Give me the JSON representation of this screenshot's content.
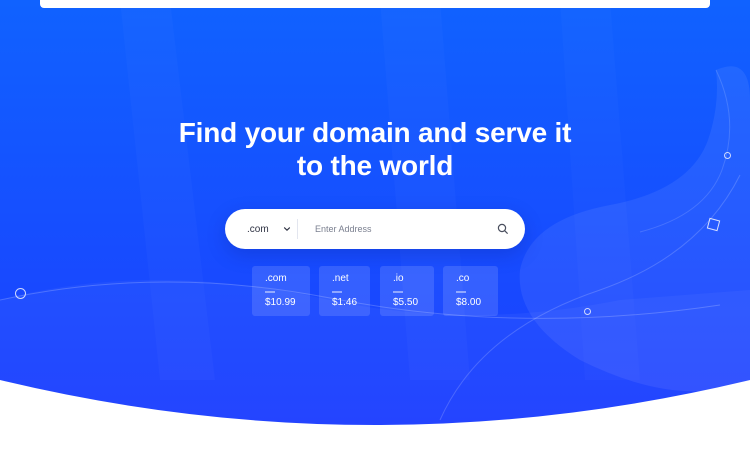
{
  "hero": {
    "headline_line1": "Find your domain and serve it",
    "headline_line2": "to the world",
    "background_gradient": [
      "#1062ff",
      "#1c3dff"
    ]
  },
  "search": {
    "selected_tld": ".com",
    "placeholder": "Enter Address",
    "value": "",
    "search_icon": "search-icon",
    "dropdown_icon": "chevron-down-icon"
  },
  "pricing": [
    {
      "ext": ".com",
      "price": "$10.99"
    },
    {
      "ext": ".net",
      "price": "$1.46"
    },
    {
      "ext": ".io",
      "price": "$5.50"
    },
    {
      "ext": ".co",
      "price": "$8.00"
    }
  ]
}
